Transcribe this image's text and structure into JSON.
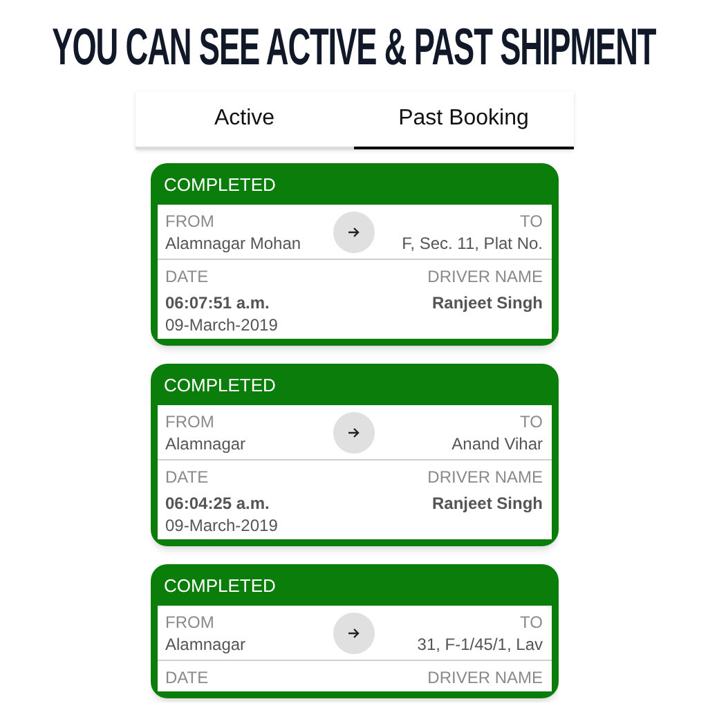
{
  "headline": "YOU CAN SEE ACTIVE & PAST SHIPMENT",
  "tabs": [
    {
      "label": "Active",
      "selected": false
    },
    {
      "label": "Past Booking",
      "selected": true
    }
  ],
  "bookings": [
    {
      "status": "COMPLETED",
      "from_label": "FROM",
      "from": "Alamnagar Mohan",
      "to_label": "TO",
      "to": "F, Sec. 11, Plat No.",
      "date_label": "DATE",
      "time": "06:07:51 a.m.",
      "date": "09-March-2019",
      "driver_label": "DRIVER NAME",
      "driver": "Ranjeet Singh"
    },
    {
      "status": "COMPLETED",
      "from_label": "FROM",
      "from": "Alamnagar",
      "to_label": "TO",
      "to": "Anand Vihar",
      "date_label": "DATE",
      "time": "06:04:25 a.m.",
      "date": "09-March-2019",
      "driver_label": "DRIVER NAME",
      "driver": "Ranjeet Singh"
    },
    {
      "status": "COMPLETED",
      "from_label": "FROM",
      "from": "Alamnagar",
      "to_label": "TO",
      "to": "31, F-1/45/1, Lav",
      "date_label": "DATE",
      "driver_label": "DRIVER NAME"
    }
  ]
}
